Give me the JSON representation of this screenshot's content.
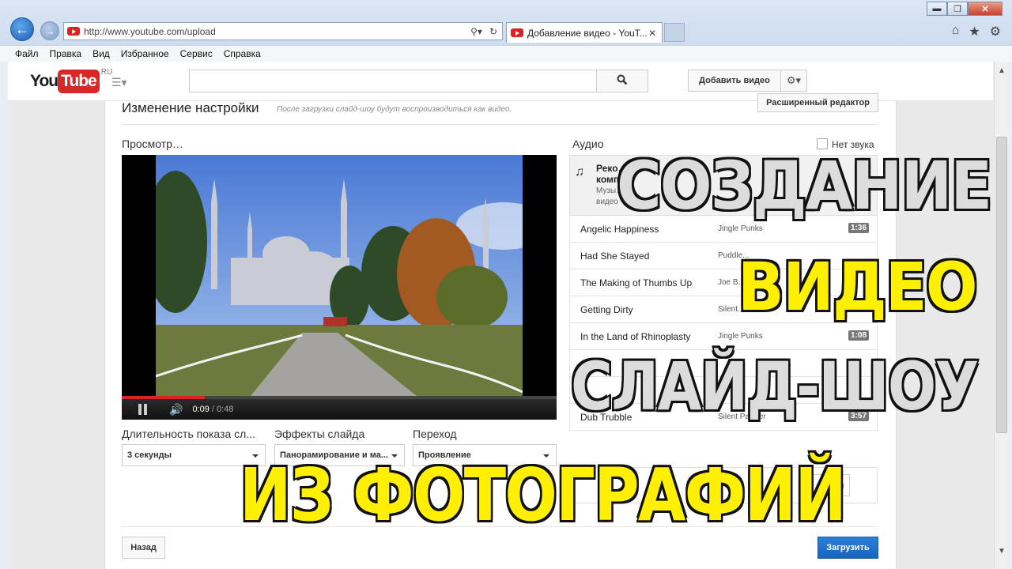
{
  "browser": {
    "address": "http://www.youtube.com/upload",
    "tab_title": "Добавление видео - YouT...",
    "tab_close": "✕",
    "menu": [
      "Файл",
      "Правка",
      "Вид",
      "Избранное",
      "Сервис",
      "Справка"
    ],
    "window_controls": {
      "minimize": "▬",
      "maximize": "❐",
      "close": "✕"
    },
    "tools": {
      "home": "⌂",
      "favorites": "★",
      "settings": "⚙"
    },
    "nav": {
      "back": "←",
      "forward": "→"
    }
  },
  "youtube": {
    "logo_you": "You",
    "logo_tube": "Tube",
    "logo_region": "RU",
    "upload_button": "Добавить видео",
    "guide_icon": "☰▾",
    "search_icon": "🔍",
    "settings_icon": "⚙▾"
  },
  "editor": {
    "advanced_editor_button": "Расширенный редактор",
    "title": "Изменение настройки",
    "hint": "После загрузки слайд-шоу будут воспроизводиться как видео.",
    "preview_label": "Просмотр…",
    "player": {
      "current_time": "0:09",
      "duration": "/ 0:48",
      "progress": 0.19,
      "volume_icon": "🔊"
    },
    "fields": [
      {
        "label": "Длительность показа сл...",
        "value": "3 секунды"
      },
      {
        "label": "Эффекты слайда",
        "value": "Панорамирование и ма..."
      },
      {
        "label": "Переход",
        "value": "Проявление"
      }
    ],
    "back_button": "Назад",
    "submit_button": "Загрузить"
  },
  "audio": {
    "label": "Аудио",
    "mute_label": "Нет звука",
    "recommended_icon": "♫",
    "recommended_title": "Реко… комп…",
    "recommended_sub": "Музы… видео",
    "tracks": [
      {
        "title": "Angelic Happiness",
        "artist": "Jingle Punks",
        "duration": "1:36"
      },
      {
        "title": "Had She Stayed",
        "artist": "Puddle...",
        "duration": ""
      },
      {
        "title": "The Making of Thumbs Up",
        "artist": "Joe B...",
        "duration": ""
      },
      {
        "title": "Getting Dirty",
        "artist": "Silent...",
        "duration": ""
      },
      {
        "title": "In the Land of Rhinoplasty",
        "artist": "Jingle Punks",
        "duration": "1:08"
      },
      {
        "title": "",
        "artist": "",
        "duration": ""
      },
      {
        "title": "",
        "artist": "",
        "duration": ""
      },
      {
        "title": "Dub Trubble",
        "artist": "Silent Partner",
        "duration": "3:57"
      }
    ],
    "search_value": "000)"
  },
  "overlay": {
    "line1": "СОЗДАНИЕ",
    "line2": "ВИДЕО",
    "line3": "СЛАЙД-ШОУ",
    "line4": "ИЗ ФОТОГРАФИЙ"
  },
  "colors": {
    "brand_red": "#d72727",
    "submit_blue": "#1864bd",
    "overlay_yellow": "#ffef00",
    "overlay_white": "#dcdcdc"
  }
}
